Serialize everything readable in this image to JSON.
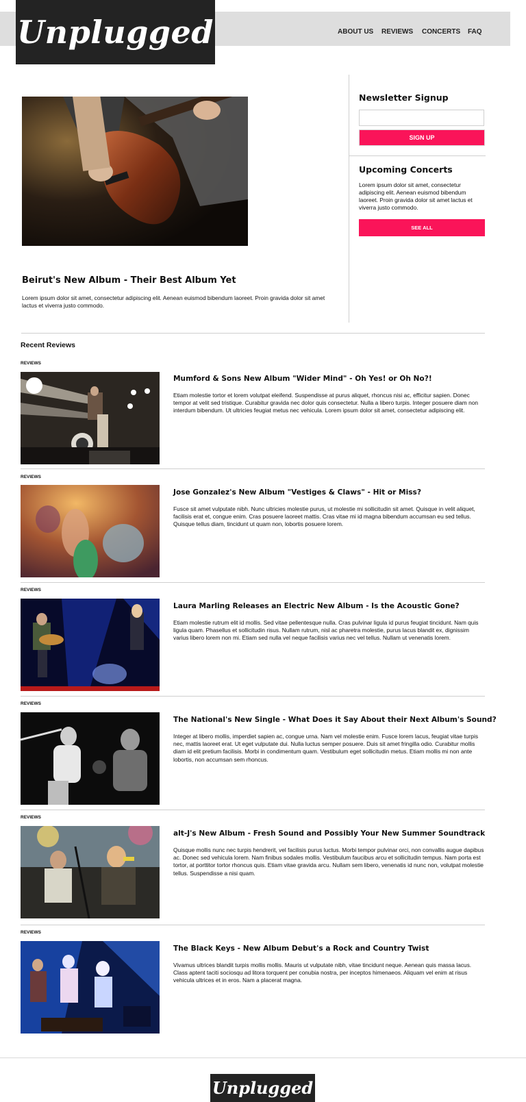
{
  "site": {
    "logo_text": "Unplugged"
  },
  "nav": [
    {
      "label": "ABOUT US"
    },
    {
      "label": "REVIEWS"
    },
    {
      "label": "CONCERTS"
    },
    {
      "label": "FAQ"
    }
  ],
  "featured": {
    "title": "Beirut's New Album - Their Best Album Yet",
    "text": "Lorem ipsum dolor sit amet, consectetur adipiscing elit. Aenean euismod bibendum laoreet. Proin gravida dolor sit amet lactus et viverra justo commodo."
  },
  "sidebar": {
    "newsletter_heading": "Newsletter Signup",
    "email_value": "",
    "signup_label": "SIGN UP",
    "concerts_heading": "Upcoming Concerts",
    "concerts_text": "Lorem ipsum dolor sit amet, consectetur adipiscing elit. Aenean euismod bibendum laoreet. Proin gravida dolor sit amet lactus et viverra justo commodo.",
    "see_all_label": "SEE ALL"
  },
  "reviews": {
    "heading": "Recent Reviews",
    "items": [
      {
        "tag": "REVIEWS",
        "title": "Mumford & Sons New Album \"Wider Mind\" - Oh Yes! or Oh No?!",
        "text": "Etiam molestie tortor et lorem volutpat eleifend. Suspendisse at purus aliquet, rhoncus nisi ac, efficitur sapien. Donec tempor at velit sed tristique. Curabitur gravida nec dolor quis consectetur. Nulla a libero turpis. Integer posuere diam non interdum bibendum. Ut ultricies feugiat metus nec vehicula. Lorem ipsum dolor sit amet, consectetur adipiscing elit."
      },
      {
        "tag": "REVIEWS",
        "title": "Jose Gonzalez's New Album \"Vestiges & Claws\" - Hit or Miss?",
        "text": "Fusce sit amet vulputate nibh. Nunc ultricies molestie purus, ut molestie mi sollicitudin sit amet. Quisque in velit aliquet, facilisis erat et, congue enim. Cras posuere laoreet mattis. Cras vitae mi id magna bibendum accumsan eu sed tellus. Quisque tellus diam, tincidunt ut quam non, lobortis posuere lorem."
      },
      {
        "tag": "REVIEWS",
        "title": "Laura Marling Releases an Electric New Album - Is the Acoustic Gone?",
        "text": "Etiam molestie rutrum elit id mollis. Sed vitae pellentesque nulla. Cras pulvinar ligula id purus feugiat tincidunt. Nam quis ligula quam. Phasellus et sollicitudin risus. Nullam rutrum, nisl ac pharetra molestie, purus lacus blandit ex, dignissim varius libero lorem non mi. Etiam sed nulla vel neque facilisis varius nec vel tellus. Nullam ut venenatis lorem."
      },
      {
        "tag": "REVIEWS",
        "title": "The National's New Single - What Does it Say About their Next Album's Sound?",
        "text": "Integer at libero mollis, imperdiet sapien ac, congue urna. Nam vel molestie enim. Fusce lorem lacus, feugiat vitae turpis nec, mattis laoreet erat. Ut eget vulputate dui. Nulla luctus semper posuere. Duis sit amet fringilla odio. Curabitur mollis diam id elit pretium facilisis. Morbi in condimentum quam. Vestibulum eget sollicitudin metus. Etiam mollis mi non ante lobortis, non accumsan sem rhoncus."
      },
      {
        "tag": "REVIEWS",
        "title": "alt-J's New Album - Fresh Sound and Possibly Your New Summer Soundtrack",
        "text": "Quisque mollis nunc nec turpis hendrerit, vel facilisis purus luctus. Morbi tempor pulvinar orci, non convallis augue dapibus ac. Donec sed vehicula lorem. Nam finibus sodales mollis. Vestibulum faucibus arcu et sollicitudin tempus. Nam porta est tortor, at porttitor tortor rhoncus quis. Etiam vitae gravida arcu. Nullam sem libero, venenatis id nunc non, volutpat molestie tellus. Suspendisse a nisi quam."
      },
      {
        "tag": "REVIEWS",
        "title": "The Black Keys - New Album Debut's a Rock and Country Twist",
        "text": "Vivamus ultrices blandit turpis mollis mollis. Mauris ut vulputate nibh, vitae tincidunt neque. Aenean quis massa lacus. Class aptent taciti sociosqu ad litora torquent per conubia nostra, per inceptos himenaeos. Aliquam vel enim at risus vehicula ultrices et in eros. Nam a placerat magna."
      }
    ]
  },
  "footer": {
    "logo_text": "Unplugged"
  },
  "colors": {
    "accent": "#fa1459",
    "logo_bg": "#232323",
    "header_bg": "#dedede"
  }
}
